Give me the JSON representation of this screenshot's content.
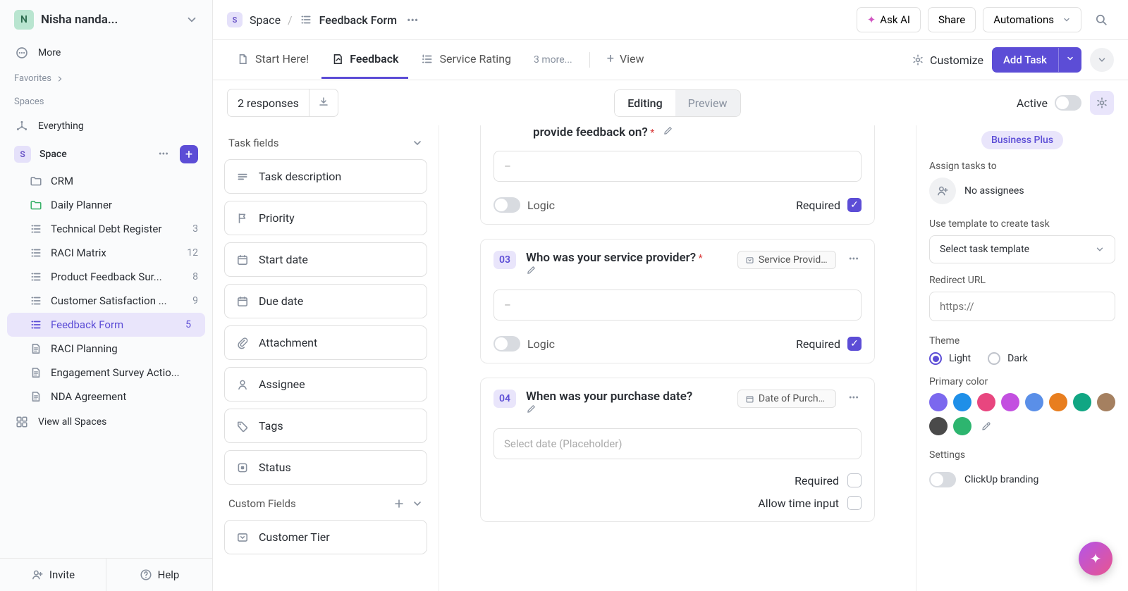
{
  "workspace": {
    "name": "Nisha nanda...",
    "initial": "N"
  },
  "sidebar": {
    "more": "More",
    "favorites": "Favorites",
    "spaces": "Spaces",
    "everything": "Everything",
    "space_name": "Space",
    "space_initial": "S",
    "items": [
      {
        "label": "CRM",
        "icon": "folder"
      },
      {
        "label": "Daily Planner",
        "icon": "folder-green"
      },
      {
        "label": "Technical Debt Register",
        "icon": "list",
        "count": "3"
      },
      {
        "label": "RACI Matrix",
        "icon": "list",
        "count": "12"
      },
      {
        "label": "Product Feedback Sur...",
        "icon": "list",
        "count": "8"
      },
      {
        "label": "Customer Satisfaction ...",
        "icon": "list",
        "count": "9"
      },
      {
        "label": "Feedback Form",
        "icon": "list",
        "count": "5",
        "active": true
      },
      {
        "label": "RACI Planning",
        "icon": "doc"
      },
      {
        "label": "Engagement Survey Actio...",
        "icon": "doc"
      },
      {
        "label": "NDA Agreement",
        "icon": "doc"
      }
    ],
    "view_all": "View all Spaces",
    "invite": "Invite",
    "help": "Help"
  },
  "breadcrumb": {
    "space": "Space",
    "space_initial": "S",
    "page": "Feedback Form"
  },
  "topbar": {
    "ask_ai": "Ask AI",
    "share": "Share",
    "automations": "Automations"
  },
  "tabs": {
    "items": [
      {
        "label": "Start Here!",
        "icon": "doc-pin"
      },
      {
        "label": "Feedback",
        "icon": "form",
        "active": true
      },
      {
        "label": "Service Rating",
        "icon": "list-ol"
      }
    ],
    "more": "3 more...",
    "add_view": "View",
    "customize": "Customize",
    "add_task": "Add Task"
  },
  "toolbar": {
    "responses": "2 responses",
    "editing": "Editing",
    "preview": "Preview",
    "active": "Active"
  },
  "task_fields": {
    "title": "Task fields",
    "items": [
      "Task description",
      "Priority",
      "Start date",
      "Due date",
      "Attachment",
      "Assignee",
      "Tags",
      "Status"
    ],
    "custom_fields": "Custom Fields",
    "custom_items": [
      "Customer Tier"
    ]
  },
  "questions": {
    "partial": {
      "title_fragment": "provide feedback on?",
      "dash": "–",
      "logic": "Logic",
      "required": "Required"
    },
    "q3": {
      "num": "03",
      "title": "Who was your service provider?",
      "badge": "Service Provider",
      "dash": "–",
      "logic": "Logic",
      "required": "Required"
    },
    "q4": {
      "num": "04",
      "title": "When was your purchase date?",
      "badge": "Date of Purcha...",
      "placeholder": "Select date (Placeholder)",
      "required": "Required",
      "allow_time": "Allow time input"
    }
  },
  "right_panel": {
    "plan": "Business Plus",
    "assign_label": "Assign tasks to",
    "no_assignees": "No assignees",
    "template_label": "Use template to create task",
    "template_placeholder": "Select task template",
    "redirect_label": "Redirect URL",
    "redirect_placeholder": "https://",
    "theme_label": "Theme",
    "theme_light": "Light",
    "theme_dark": "Dark",
    "primary_color_label": "Primary color",
    "colors": [
      "#7b68ee",
      "#1f8fe8",
      "#e8467f",
      "#c350e0",
      "#5a8fe8",
      "#e87e1f",
      "#11a683",
      "#a58060",
      "#4a4a4a",
      "#2db56f"
    ],
    "settings_label": "Settings",
    "branding": "ClickUp branding"
  }
}
